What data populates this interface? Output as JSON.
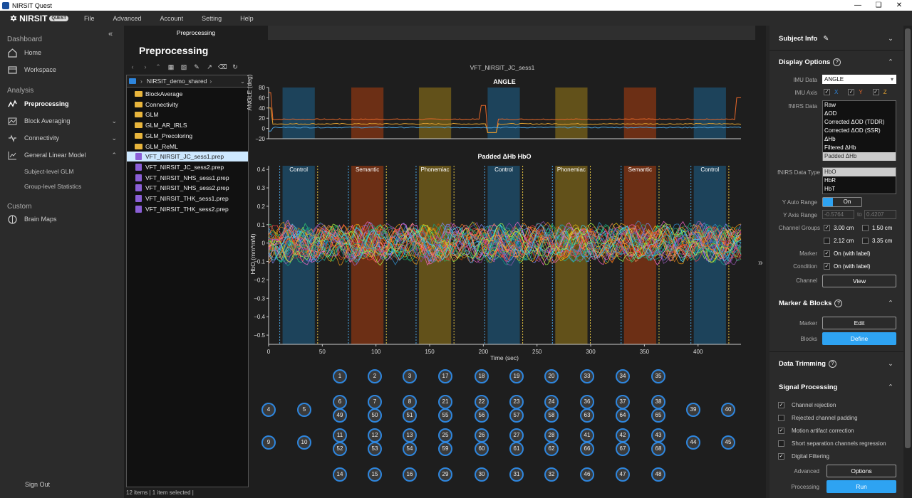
{
  "window": {
    "title": "NIRSIT Quest"
  },
  "menu": {
    "brand": "NIRSIT",
    "brand_badge": "QUEST",
    "items": [
      "File",
      "Advanced",
      "Account",
      "Setting",
      "Help"
    ]
  },
  "sidebar": {
    "dashboard": "Dashboard",
    "home": "Home",
    "workspace": "Workspace",
    "analysis": "Analysis",
    "preprocessing": "Preprocessing",
    "block_averaging": "Block Averaging",
    "connectivity": "Connectivity",
    "glm": "General Linear Model",
    "glm_subject": "Subject-level GLM",
    "glm_group": "Group-level Statistics",
    "custom": "Custom",
    "brain_maps": "Brain Maps",
    "sign_out": "Sign Out"
  },
  "tab": "Preprocessing",
  "page_title": "Preprocessing",
  "browser": {
    "path": "NIRSIT_demo_shared",
    "folders": [
      "BlockAverage",
      "Connectivity",
      "GLM",
      "GLM_AR_IRLS",
      "GLM_Precoloring",
      "GLM_ReML"
    ],
    "files": [
      "VFT_NIRSIT_JC_sess1.prep",
      "VFT_NIRSIT_JC_sess2.prep",
      "VFT_NIRSIT_NHS_sess1.prep",
      "VFT_NIRSIT_NHS_sess2.prep",
      "VFT_NIRSIT_THK_sess1.prep",
      "VFT_NIRSIT_THK_sess2.prep"
    ],
    "selected": "VFT_NIRSIT_JC_sess1.prep",
    "status": "12 items | 1 item selected |"
  },
  "chart_data": [
    {
      "type": "line",
      "title": "ANGLE",
      "ylabel": "ANGLE (deg)",
      "ylim": [
        -20,
        80
      ],
      "yticks": [
        "80",
        "60",
        "40",
        "20",
        "0",
        "−20"
      ],
      "series": [
        {
          "color": "#e8682a"
        },
        {
          "color": "#e0a030"
        },
        {
          "color": "#4aa3df"
        }
      ]
    },
    {
      "type": "line",
      "title": "Padded ΔHb HbO",
      "xlabel": "Time (sec)",
      "ylabel": "HbO (mm*mM)",
      "xlim": [
        0,
        440
      ],
      "ylim": [
        -0.55,
        0.42
      ],
      "xticks": [
        "0",
        "50",
        "100",
        "150",
        "200",
        "250",
        "300",
        "350",
        "400"
      ],
      "yticks": [
        "0.4",
        "0.3",
        "0.2",
        "0.1",
        "0",
        "−0.1",
        "−0.2",
        "−0.3",
        "−0.4",
        "−0.5"
      ],
      "blocks": [
        {
          "label": "Control",
          "start": 13,
          "end": 43,
          "color": "#1d4a66"
        },
        {
          "label": "Semantic",
          "start": 77,
          "end": 107,
          "color": "#7a3214"
        },
        {
          "label": "Phonemiac",
          "start": 140,
          "end": 170,
          "color": "#6e5a1a"
        },
        {
          "label": "Control",
          "start": 204,
          "end": 234,
          "color": "#1d4a66"
        },
        {
          "label": "Phonemiac",
          "start": 267,
          "end": 297,
          "color": "#6e5a1a"
        },
        {
          "label": "Semantic",
          "start": 331,
          "end": 361,
          "color": "#7a3214"
        },
        {
          "label": "Control",
          "start": 396,
          "end": 426,
          "color": "#1d4a66"
        }
      ]
    }
  ],
  "file_label": "VFT_NIRSIT_JC_sess1",
  "channels": {
    "row1": [
      "1",
      "2",
      "3",
      "17",
      "18",
      "19",
      "20",
      "33",
      "34",
      "35"
    ],
    "row2": [
      "6",
      "7",
      "8",
      "21",
      "22",
      "23",
      "24",
      "36",
      "37",
      "38"
    ],
    "row3": [
      "49",
      "50",
      "51",
      "55",
      "56",
      "57",
      "58",
      "63",
      "64",
      "65"
    ],
    "row4": [
      "11",
      "12",
      "13",
      "25",
      "26",
      "27",
      "28",
      "41",
      "42",
      "43"
    ],
    "row5": [
      "52",
      "53",
      "54",
      "59",
      "60",
      "61",
      "62",
      "66",
      "67",
      "68"
    ],
    "row6": [
      "14",
      "15",
      "16",
      "29",
      "30",
      "31",
      "32",
      "46",
      "47",
      "48"
    ],
    "side": [
      "4",
      "5",
      "39",
      "40",
      "9",
      "10",
      "44",
      "45"
    ]
  },
  "right": {
    "subject_info": "Subject Info",
    "display_options": "Display Options",
    "imu_data_label": "IMU Data",
    "imu_data": "ANGLE",
    "imu_axis_label": "IMU Axis",
    "axes": [
      "X",
      "Y",
      "Z"
    ],
    "fnirs_data_label": "fNIRS Data",
    "fnirs_data": [
      "Raw",
      "ΔOD",
      "Corrected ΔOD (TDDR)",
      "Corrected ΔOD (SSR)",
      "ΔHb",
      "Filtered ΔHb",
      "Padded ΔHb"
    ],
    "fnirs_type_label": "fNIRS Data Type",
    "fnirs_types": [
      "HbO",
      "HbR",
      "HbT"
    ],
    "y_auto_label": "Y Auto Range",
    "y_auto": "On",
    "y_axis_label": "Y Axis Range",
    "y_min": "-0.5764",
    "y_to": "to",
    "y_max": "0.4207",
    "channel_groups_label": "Channel Groups",
    "groups": [
      "3.00 cm",
      "1.50 cm",
      "2.12 cm",
      "3.35 cm"
    ],
    "marker_label": "Marker",
    "marker_val": "On (with label)",
    "condition_label": "Condition",
    "condition_val": "On (with label)",
    "channel_label": "Channel",
    "view": "View",
    "marker_blocks": "Marker & Blocks",
    "marker2": "Marker",
    "edit": "Edit",
    "blocks": "Blocks",
    "define": "Define",
    "data_trimming": "Data Trimming",
    "signal_processing": "Signal Processing",
    "sp_items": [
      "Channel rejection",
      "Rejected channel padding",
      "Motion artifact correction",
      "Short separation channels regression",
      "Digital Filtering"
    ],
    "advanced": "Advanced",
    "options": "Options",
    "processing": "Processing",
    "run": "Run"
  }
}
